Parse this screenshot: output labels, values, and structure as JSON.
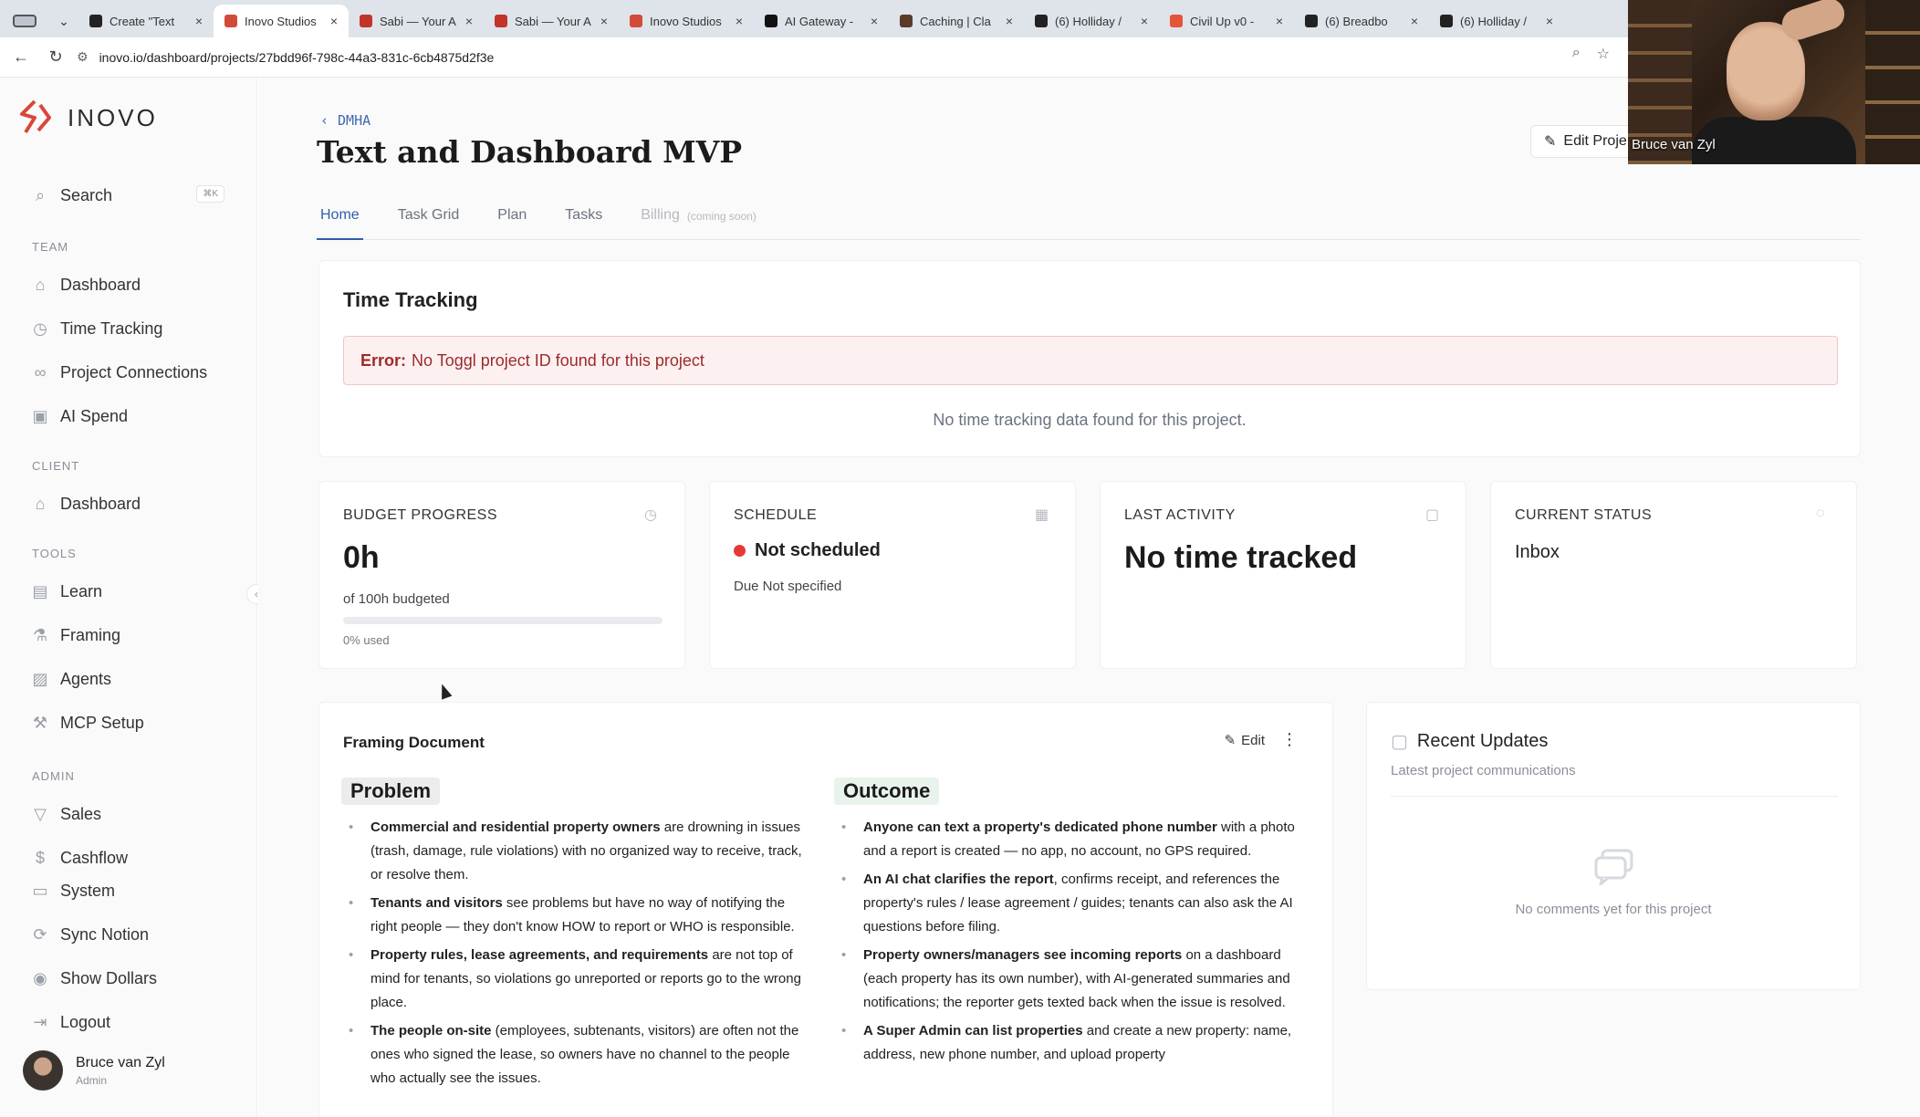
{
  "browser": {
    "tabs": [
      {
        "title": "Create \"Text",
        "color": "#222222"
      },
      {
        "title": "Inovo Studios",
        "color": "#d24b3a",
        "active": true
      },
      {
        "title": "Sabi — Your A",
        "color": "#c2342a"
      },
      {
        "title": "Sabi — Your A",
        "color": "#c2342a"
      },
      {
        "title": "Inovo Studios",
        "color": "#d24b3a"
      },
      {
        "title": "AI Gateway -",
        "color": "#111111"
      },
      {
        "title": "Caching | Cla",
        "color": "#5b3a2a"
      },
      {
        "title": "(6) Holliday /",
        "color": "#222222"
      },
      {
        "title": "Civil Up v0 -",
        "color": "#e5533a"
      },
      {
        "title": "(6) Breadbo",
        "color": "#222222"
      },
      {
        "title": "(6) Holliday /",
        "color": "#222222"
      }
    ],
    "url": "inovo.io/dashboard/projects/27bdd96f-798c-44a3-831c-6cb4875d2f3e"
  },
  "sidebar": {
    "logo_text": "INOVO",
    "search_label": "Search",
    "search_shortcut": "⌘K",
    "sections": {
      "team": "TEAM",
      "client": "CLIENT",
      "tools": "TOOLS",
      "admin": "ADMIN"
    },
    "team_items": [
      "Dashboard",
      "Time Tracking",
      "Project Connections",
      "AI Spend"
    ],
    "client_items": [
      "Dashboard"
    ],
    "tools_items": [
      "Learn",
      "Framing",
      "Agents",
      "MCP Setup"
    ],
    "admin_items": [
      "Sales",
      "Cashflow",
      "System",
      "Sync Notion",
      "Show Dollars",
      "Logout"
    ],
    "user": {
      "name": "Bruce van Zyl",
      "role": "Admin"
    }
  },
  "project": {
    "breadcrumb": "DMHA",
    "title": "Text and Dashboard MVP",
    "edit_label": "Edit Proje",
    "tabs": [
      {
        "label": "Home",
        "state": "active"
      },
      {
        "label": "Task Grid",
        "state": "normal"
      },
      {
        "label": "Plan",
        "state": "normal"
      },
      {
        "label": "Tasks",
        "state": "normal"
      },
      {
        "label": "Billing",
        "state": "disabled",
        "suffix": "(coming soon)"
      }
    ]
  },
  "time_tracking": {
    "title": "Time Tracking",
    "error_prefix": "Error:",
    "error_text": "No Toggl project ID found for this project",
    "empty_text": "No time tracking data found for this project."
  },
  "stats": {
    "budget": {
      "label": "BUDGET PROGRESS",
      "value": "0h",
      "sub": "of 100h budgeted",
      "used": "0% used",
      "used_fraction": 0
    },
    "schedule": {
      "label": "SCHEDULE",
      "status": "Not scheduled",
      "due": "Due Not specified"
    },
    "activity": {
      "label": "LAST ACTIVITY",
      "value": "No time tracked"
    },
    "status": {
      "label": "CURRENT STATUS",
      "value": "Inbox"
    }
  },
  "framing": {
    "title": "Framing Document",
    "edit_label": "Edit",
    "problem": {
      "heading": "Problem",
      "items": [
        {
          "bold": "Commercial and residential property owners",
          "rest": " are drowning in issues (trash, damage, rule violations) with no organized way to receive, track, or resolve them."
        },
        {
          "bold": "Tenants and visitors",
          "rest": " see problems but have no way of notifying the right people — they don't know HOW to report or WHO is responsible."
        },
        {
          "bold": "Property rules, lease agreements, and requirements",
          "rest": " are not top of mind for tenants, so violations go unreported or reports go to the wrong place."
        },
        {
          "bold": "The people on-site",
          "rest": " (employees, subtenants, visitors) are often not the ones who signed the lease, so owners have no channel to the people who actually see the issues."
        }
      ]
    },
    "outcome": {
      "heading": "Outcome",
      "items": [
        {
          "bold": "Anyone can text a property's dedicated phone number",
          "rest": " with a photo and a report is created — no app, no account, no GPS required."
        },
        {
          "bold": "An AI chat clarifies the report",
          "rest": ", confirms receipt, and references the property's rules / lease agreement / guides; tenants can also ask the AI questions before filing."
        },
        {
          "bold": "Property owners/managers see incoming reports",
          "rest": " on a dashboard (each property has its own number), with AI-generated summaries and notifications; the reporter gets texted back when the issue is resolved."
        },
        {
          "bold": "A Super Admin can list properties",
          "rest": " and create a new property: name, address, new phone number, and upload property"
        }
      ]
    }
  },
  "updates": {
    "title": "Recent Updates",
    "subtitle": "Latest project communications",
    "empty_text": "No comments yet for this project"
  },
  "webcam": {
    "name": "Bruce van Zyl"
  },
  "colors": {
    "accent": "#2f5fa8",
    "error": "#9e2a2a",
    "logo": "#d9473a"
  }
}
